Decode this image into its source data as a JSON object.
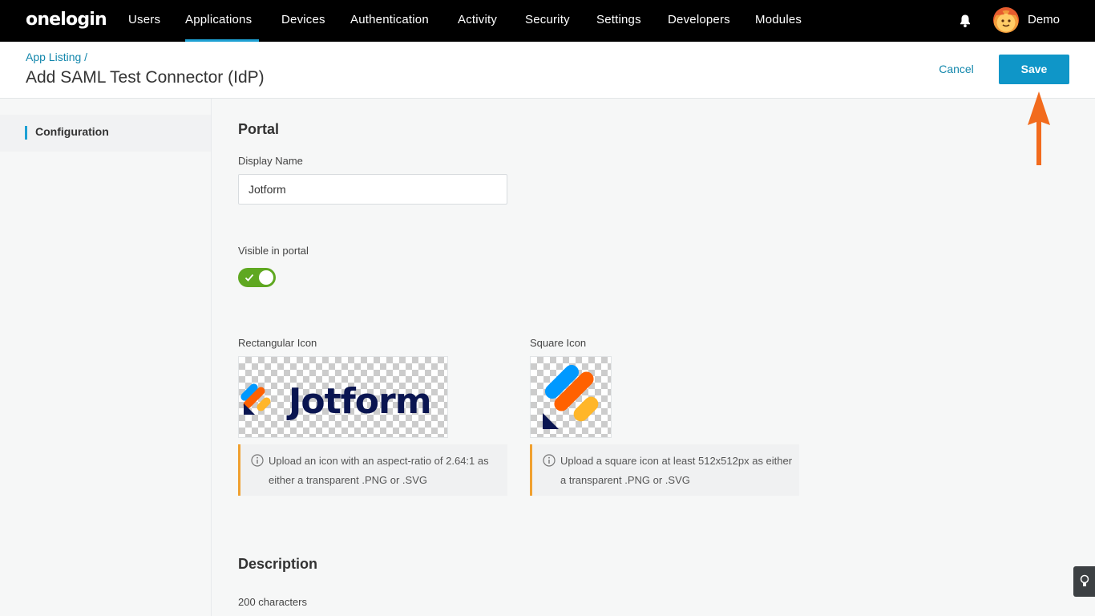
{
  "app": {
    "logo": "onelogin"
  },
  "nav": {
    "items": [
      {
        "label": "Users"
      },
      {
        "label": "Applications",
        "active": true
      },
      {
        "label": "Devices"
      },
      {
        "label": "Authentication"
      },
      {
        "label": "Activity"
      },
      {
        "label": "Security"
      },
      {
        "label": "Settings"
      },
      {
        "label": "Developers"
      },
      {
        "label": "Modules"
      }
    ],
    "notification_icon": "bell-icon",
    "user": {
      "name": "Demo",
      "avatar_icon": "avatar"
    }
  },
  "header": {
    "breadcrumb": "App Listing /",
    "title": "Add SAML Test Connector (IdP)",
    "cancel_label": "Cancel",
    "save_label": "Save"
  },
  "sidebar": {
    "items": [
      {
        "label": "Configuration",
        "active": true
      }
    ]
  },
  "portal": {
    "section_title": "Portal",
    "display_name_label": "Display Name",
    "display_name_value": "Jotform",
    "visible_label": "Visible in portal",
    "visible_on": true,
    "rect_icon_label": "Rectangular Icon",
    "rect_icon_text": "Jotform",
    "rect_icon_info": "Upload an icon with an aspect-ratio of 2.64:1 as either a transparent .PNG or .SVG",
    "square_icon_label": "Square Icon",
    "square_icon_info": "Upload a square icon at least 512x512px as either a transparent .PNG or .SVG"
  },
  "description": {
    "section_title": "Description",
    "chars_label": "200 characters"
  },
  "colors": {
    "accent": "#0f96c8",
    "link": "#1387ac",
    "toggle_on": "#5fa821",
    "info_border": "#f0a030",
    "annotation_arrow": "#f26b1d",
    "jotform_navy": "#0a1551",
    "jotform_blue": "#0099ff",
    "jotform_orange": "#ff6100",
    "jotform_yellow": "#ffb629"
  }
}
